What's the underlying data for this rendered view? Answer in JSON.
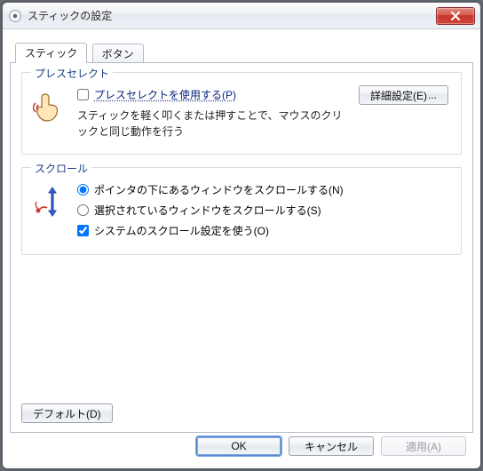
{
  "window": {
    "title": "スティックの設定"
  },
  "tabs": {
    "stick": "スティック",
    "button": "ボタン"
  },
  "press_select": {
    "group_title": "プレスセレクト",
    "checkbox_label": "プレスセレクトを使用する(P)",
    "checked": false,
    "description": "スティックを軽く叩くまたは押すことで、マウスのクリックと同じ動作を行う",
    "advanced_button": "詳細設定(E)"
  },
  "scroll": {
    "group_title": "スクロール",
    "opt_pointer": "ポインタの下にあるウィンドウをスクロールする(N)",
    "opt_selected": "選択されているウィンドウをスクロールする(S)",
    "radio_value": "pointer",
    "use_system_label": "システムのスクロール設定を使う(O)",
    "use_system_checked": true
  },
  "buttons": {
    "defaults": "デフォルト(D)",
    "ok": "OK",
    "cancel": "キャンセル",
    "apply": "適用(A)"
  }
}
